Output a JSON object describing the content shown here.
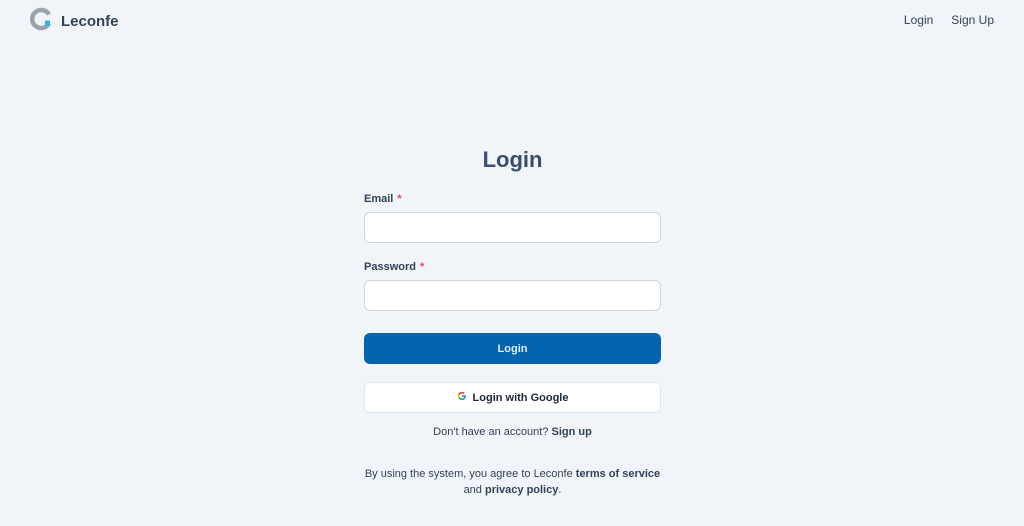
{
  "header": {
    "brand_name": "Leconfe",
    "logo_icon": "leconfe-logo-icon",
    "nav": {
      "login": "Login",
      "signup": "Sign Up"
    }
  },
  "form": {
    "title": "Login",
    "email_label": "Email",
    "password_label": "Password",
    "required_mark": "*",
    "email_value": "",
    "password_value": "",
    "login_button": "Login",
    "google_button": "Login with Google",
    "google_icon": "google-icon",
    "signup_prompt": "Don't have an account?",
    "signup_link": "Sign up"
  },
  "terms": {
    "prefix": "By using the system, you agree to Leconfe",
    "terms_link": "terms of service",
    "and": "and",
    "privacy_link": "privacy policy",
    "suffix": "."
  },
  "colors": {
    "background": "#f1f5f9",
    "primary": "#0564ae",
    "required": "#ef4444",
    "logo_accent": "#29b6e8",
    "logo_gray": "#9ca3af"
  }
}
